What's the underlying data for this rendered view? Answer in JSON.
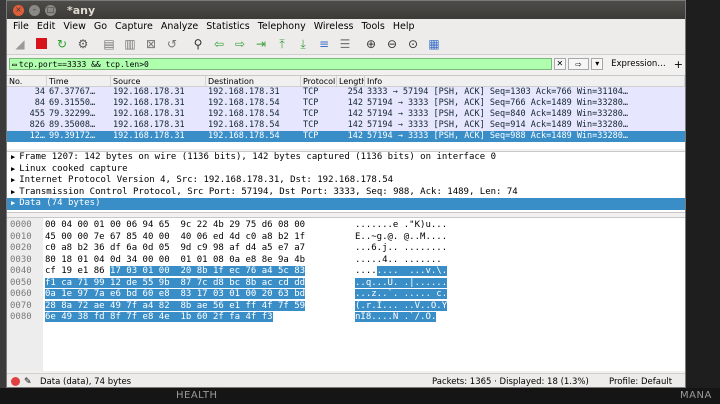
{
  "window": {
    "title": "*any"
  },
  "menu": [
    "File",
    "Edit",
    "View",
    "Go",
    "Capture",
    "Analyze",
    "Statistics",
    "Telephony",
    "Wireless",
    "Tools",
    "Help"
  ],
  "filter": {
    "value": "tcp.port==3333 && tcp.len>0",
    "expression_label": "Expression…",
    "plus_label": "+"
  },
  "packet_list": {
    "columns": [
      "No.",
      "Time",
      "Source",
      "Destination",
      "Protocol",
      "Length",
      "Info"
    ],
    "rows": [
      {
        "no": "34",
        "time": "67.37767…",
        "src": "192.168.178.31",
        "dst": "192.168.178.31",
        "proto": "TCP",
        "len": "254",
        "info": "3333 → 57194 [PSH, ACK] Seq=1303 Ack=766 Win=31104…",
        "selected": false
      },
      {
        "no": "84",
        "time": "69.31550…",
        "src": "192.168.178.31",
        "dst": "192.168.178.54",
        "proto": "TCP",
        "len": "142",
        "info": "57194 → 3333 [PSH, ACK] Seq=766 Ack=1489 Win=33280…",
        "selected": false
      },
      {
        "no": "455",
        "time": "79.32299…",
        "src": "192.168.178.31",
        "dst": "192.168.178.54",
        "proto": "TCP",
        "len": "142",
        "info": "57194 → 3333 [PSH, ACK] Seq=840 Ack=1489 Win=33280…",
        "selected": false
      },
      {
        "no": "826",
        "time": "89.35008…",
        "src": "192.168.178.31",
        "dst": "192.168.178.54",
        "proto": "TCP",
        "len": "142",
        "info": "57194 → 3333 [PSH, ACK] Seq=914 Ack=1489 Win=33280…",
        "selected": false
      },
      {
        "no": "12…",
        "time": "99.39172…",
        "src": "192.168.178.31",
        "dst": "192.168.178.54",
        "proto": "TCP",
        "len": "142",
        "info": "57194 → 3333 [PSH, ACK] Seq=988 Ack=1489 Win=33280…",
        "selected": true
      }
    ]
  },
  "details": [
    {
      "text": "Frame 1207: 142 bytes on wire (1136 bits), 142 bytes captured (1136 bits) on interface 0",
      "selected": false
    },
    {
      "text": "Linux cooked capture",
      "selected": false
    },
    {
      "text": "Internet Protocol Version 4, Src: 192.168.178.31, Dst: 192.168.178.54",
      "selected": false
    },
    {
      "text": "Transmission Control Protocol, Src Port: 57194, Dst Port: 3333, Seq: 988, Ack: 1489, Len: 74",
      "selected": false
    },
    {
      "text": "Data (74 bytes)",
      "selected": true
    }
  ],
  "bytes": [
    {
      "offset": "0000",
      "hex": "00 04 00 01 00 06 94 65  9c 22 4b 29 75 d6 08 00",
      "hex_hl": "",
      "ascii": ".......e .\"K)u...",
      "ascii_hl": ""
    },
    {
      "offset": "0010",
      "hex": "45 00 00 7e 67 85 40 00  40 06 ed 4d c0 a8 b2 1f",
      "hex_hl": "",
      "ascii": "E..~g.@. @..M....",
      "ascii_hl": ""
    },
    {
      "offset": "0020",
      "hex": "c0 a8 b2 36 df 6a 0d 05  9d c9 98 af d4 a5 e7 a7",
      "hex_hl": "",
      "ascii": "...6.j.. ........",
      "ascii_hl": ""
    },
    {
      "offset": "0030",
      "hex": "80 18 01 04 0d 34 00 00  01 01 08 0a e8 8e 9a 4b",
      "hex_hl": "",
      "ascii": ".....4.. .......",
      "ascii_hl": ""
    },
    {
      "offset": "0040",
      "hex": "cf 19 e1 86 ",
      "hex_hl": "17 03 01 00  20 8b 1f ec 76 a4 5c 83",
      "ascii": "....",
      "ascii_hl": "....  ...v.\\."
    },
    {
      "offset": "0050",
      "hex": "",
      "hex_hl": "f1 ca 71 99 12 de 55 9b  87 7c d8 bc 8b ac cd dd",
      "ascii": "",
      "ascii_hl": "..q...U. .|......"
    },
    {
      "offset": "0060",
      "hex": "",
      "hex_hl": "0a 1e 97 7a e6 bd 60 e8  83 17 03 01 00 20 63 bd",
      "ascii": "",
      "ascii_hl": "...z..`. ..... c."
    },
    {
      "offset": "0070",
      "hex": "",
      "hex_hl": "28 8a 72 ae 49 7f a4 82  8b ae 56 e1 ff 4f 7f 59",
      "ascii": "",
      "ascii_hl": "(.r.I... ..V..O.Y"
    },
    {
      "offset": "0080",
      "hex": "",
      "hex_hl": "6e 49 38 fd 8f 7f e8 4e  1b 60 2f fa 4f f3",
      "ascii": "",
      "ascii_hl": "nI8....N .`/.O."
    }
  ],
  "status": {
    "left": "Data (data), 74 bytes",
    "middle": "Packets: 1365 · Displayed: 18 (1.3%)",
    "right": "Profile: Default"
  },
  "background": {
    "health": "HEALTH",
    "mana": "MANA"
  }
}
